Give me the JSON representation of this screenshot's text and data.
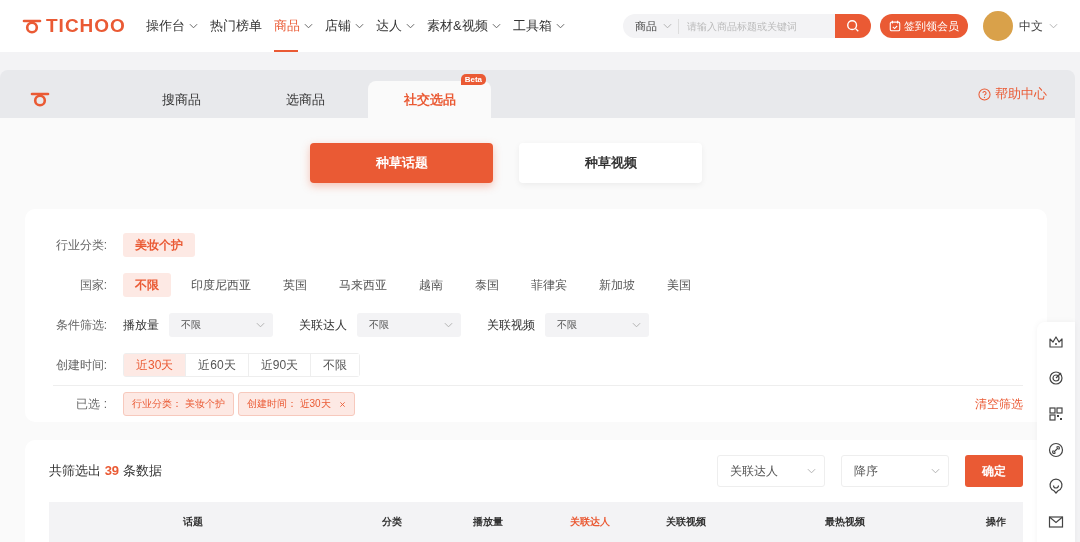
{
  "header": {
    "logo": "TICHOO",
    "nav": [
      {
        "label": "操作台",
        "dropdown": true,
        "selected": false
      },
      {
        "label": "热门榜单",
        "dropdown": false,
        "selected": false
      },
      {
        "label": "商品",
        "dropdown": true,
        "selected": true
      },
      {
        "label": "店铺",
        "dropdown": true,
        "selected": false
      },
      {
        "label": "达人",
        "dropdown": true,
        "selected": false
      },
      {
        "label": "素材&视频",
        "dropdown": true,
        "selected": false
      },
      {
        "label": "工具箱",
        "dropdown": true,
        "selected": false
      }
    ],
    "search": {
      "category": "商品",
      "placeholder": "请输入商品标题或关键词"
    },
    "checkin_button": "签到领会员",
    "language": "中文"
  },
  "tabs": [
    {
      "label": "搜商品",
      "selected": false
    },
    {
      "label": "选商品",
      "selected": false
    },
    {
      "label": "社交选品",
      "selected": true,
      "badge": "Beta"
    }
  ],
  "help_link": "帮助中心",
  "mode_buttons": [
    {
      "label": "种草话题",
      "selected": true
    },
    {
      "label": "种草视频",
      "selected": false
    }
  ],
  "filters": {
    "industry": {
      "label": "行业分类:",
      "options": [
        {
          "label": "美妆个护",
          "selected": true
        }
      ]
    },
    "country": {
      "label": "国家:",
      "options": [
        {
          "label": "不限",
          "selected": true
        },
        {
          "label": "印度尼西亚",
          "selected": false
        },
        {
          "label": "英国",
          "selected": false
        },
        {
          "label": "马来西亚",
          "selected": false
        },
        {
          "label": "越南",
          "selected": false
        },
        {
          "label": "泰国",
          "selected": false
        },
        {
          "label": "菲律宾",
          "selected": false
        },
        {
          "label": "新加坡",
          "selected": false
        },
        {
          "label": "美国",
          "selected": false
        }
      ]
    },
    "conditions": {
      "label": "条件筛选:",
      "fields": [
        {
          "label": "播放量",
          "value": "不限"
        },
        {
          "label": "关联达人",
          "value": "不限"
        },
        {
          "label": "关联视频",
          "value": "不限"
        }
      ]
    },
    "created_time": {
      "label": "创建时间:",
      "options": [
        {
          "label": "近30天",
          "selected": true
        },
        {
          "label": "近60天",
          "selected": false
        },
        {
          "label": "近90天",
          "selected": false
        },
        {
          "label": "不限",
          "selected": false
        }
      ]
    },
    "selected": {
      "label": "已选 :",
      "tags": [
        {
          "name": "行业分类：",
          "value": "美妆个护",
          "removable": false
        },
        {
          "name": "创建时间：",
          "value": "近30天",
          "removable": true
        }
      ]
    },
    "clear_link": "清空筛选"
  },
  "results": {
    "summary_prefix": "共筛选出",
    "count": "39",
    "summary_suffix": "条数据",
    "sort_field": "关联达人",
    "sort_order": "降序",
    "confirm_button": "确定",
    "columns": [
      {
        "label": "话题",
        "selected": false
      },
      {
        "label": "分类",
        "selected": false
      },
      {
        "label": "播放量",
        "selected": false
      },
      {
        "label": "关联达人",
        "selected": true
      },
      {
        "label": "关联视频",
        "selected": false
      },
      {
        "label": "最热视频",
        "selected": false
      },
      {
        "label": "操作",
        "selected": false
      }
    ]
  }
}
